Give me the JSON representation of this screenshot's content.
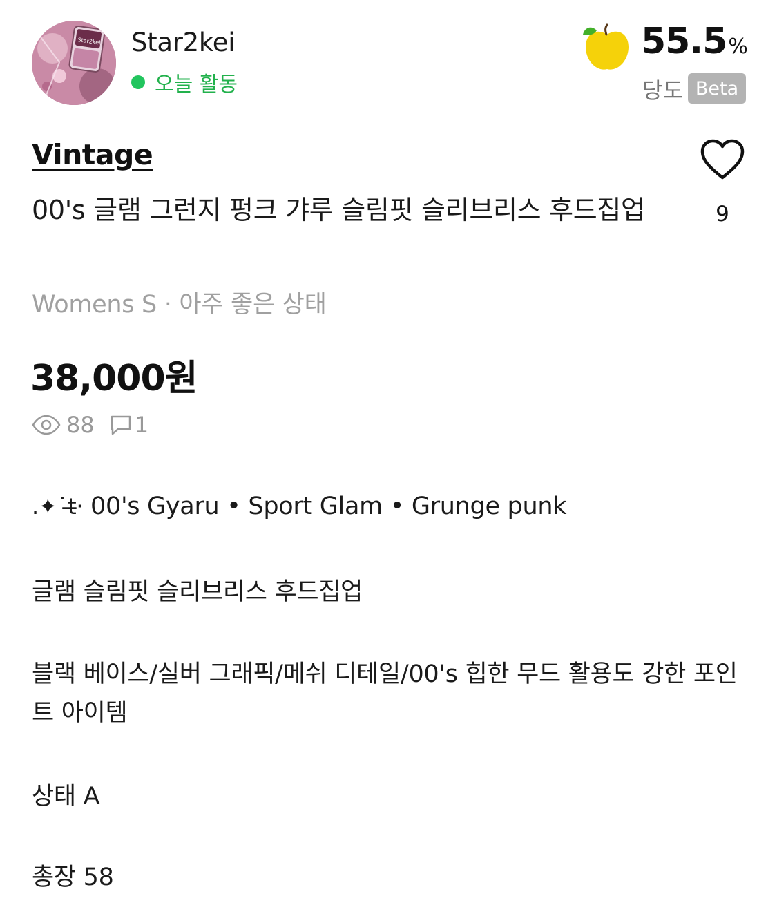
{
  "seller": {
    "username": "Star2kei",
    "status": "오늘 활동",
    "avatar_text": "Star2kei"
  },
  "sweetness": {
    "value": "55.5",
    "unit": "%",
    "label": "당도",
    "badge": "Beta"
  },
  "product": {
    "brand": "Vintage",
    "title": "00's 글램 그런지 펑크 갸루 슬림핏 슬리브리스 후드집업",
    "meta": "Womens S · 아주 좋은 상태",
    "price": "38,000원",
    "likes": "9",
    "views": "88",
    "comments": "1"
  },
  "description": {
    "line1_prefix": ".✦˙t̶̶‧",
    "line1_text": " 00's Gyaru • Sport Glam • Grunge punk",
    "line2": "글램 슬림핏 슬리브리스 후드집업",
    "line3": "블랙 베이스/실버 그래픽/메쉬 디테일/00's 힙한 무드 활용도 강한 포인트 아이템",
    "line4": "상태 A",
    "line5": "총장 58"
  },
  "colors": {
    "status_green": "#22c55e",
    "apple_yellow": "#f5d20a",
    "apple_leaf": "#43b02a",
    "muted_text": "#a0a0a0",
    "badge_bg": "#b3b3b3"
  },
  "icons": {
    "heart": "heart-outline-icon",
    "eye": "eye-icon",
    "comment": "comment-icon",
    "apple": "apple-icon"
  }
}
